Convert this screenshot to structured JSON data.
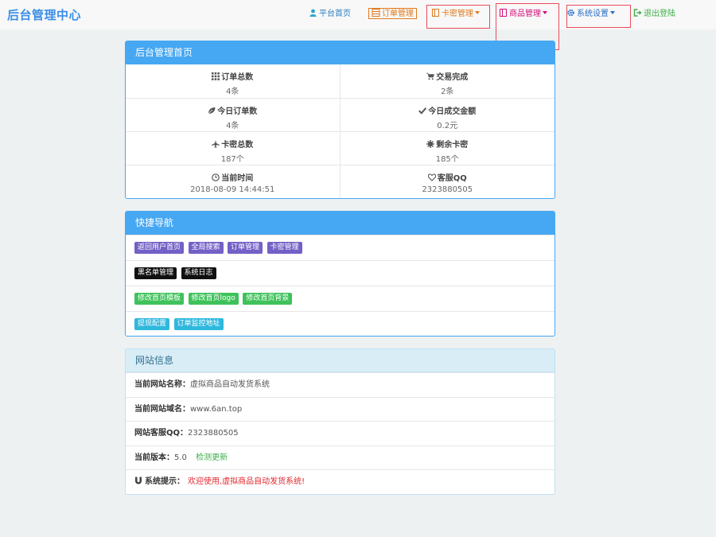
{
  "brand": "后台管理中心",
  "nav": {
    "home": "平台首页",
    "orders": "订单管理",
    "cards": "卡密管理",
    "goods": "商品管理",
    "settings": "系统设置",
    "logout": "退出登陆"
  },
  "dashboard": {
    "title": "后台管理首页",
    "stats": [
      {
        "label": "订单总数",
        "value": "4条",
        "icon": "grid-icon"
      },
      {
        "label": "交易完成",
        "value": "2条",
        "icon": "cart-icon"
      },
      {
        "label": "今日订单数",
        "value": "4条",
        "icon": "leaf-icon"
      },
      {
        "label": "今日成交金额",
        "value": "0.2元",
        "icon": "check-icon"
      },
      {
        "label": "卡密总数",
        "value": "187个",
        "icon": "plane-icon"
      },
      {
        "label": "剩余卡密",
        "value": "185个",
        "icon": "asterisk-icon"
      },
      {
        "label": "当前时间",
        "value": "2018-08-09 14:44:51",
        "icon": "clock-icon"
      },
      {
        "label": "客服QQ",
        "value": "2323880505",
        "icon": "heart-icon"
      }
    ]
  },
  "quicknav": {
    "title": "快捷导航",
    "rows": [
      [
        "返回用户首页",
        "全局搜索",
        "订单管理",
        "卡密管理"
      ],
      [
        "黑名单管理",
        "系统日志"
      ],
      [
        "修改首页模板",
        "修改首页logo",
        "修改首页背景"
      ],
      [
        "提现配置",
        "订单监控地址"
      ]
    ]
  },
  "siteinfo": {
    "title": "网站信息",
    "name_label": "当前网站名称：",
    "name_value": "虚拟商品自动发货系统",
    "domain_label": "当前网站域名：",
    "domain_value": "www.6an.top",
    "qq_label": "网站客服QQ：",
    "qq_value": "2323880505",
    "version_label": "当前版本：",
    "version_value": "5.0",
    "update_link": "检测更新",
    "tip_label": "系统提示：",
    "tip_value": "欢迎使用,虚拟商品自动发货系统!"
  },
  "colors": {
    "accent": "#46a7f2",
    "brand": "#3a8ee6",
    "orders": "#e07a20",
    "goods": "#d4117a",
    "settings": "#2a6fc9",
    "logout": "#3fae49",
    "tip": "#e0262d"
  }
}
